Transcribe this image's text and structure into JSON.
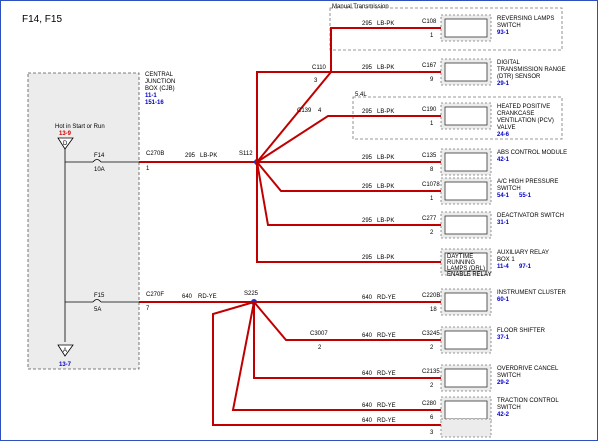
{
  "title": "F14, F15",
  "cjb": {
    "name": "CENTRAL JUNCTION BOX (CJB)",
    "ref": "11-1",
    "ref2": "151-16"
  },
  "hot_label": "Hot in Start or Run",
  "hot_ref": "13-9",
  "ground_ref": "13-7",
  "fuses": [
    {
      "name": "F14",
      "rating": "10A",
      "connector": "C270B",
      "pin": "1",
      "circuit": "295",
      "color": "LB-PK"
    },
    {
      "name": "F15",
      "rating": "5A",
      "connector": "C270F",
      "pin": "7",
      "circuit": "640",
      "color": "RD-YE"
    }
  ],
  "splices": [
    "S112",
    "S225"
  ],
  "manual_transmission": "Manual Transmission",
  "engine_tag": "5.4L",
  "connectors_mid": [
    "C110",
    "3",
    "C139",
    "4",
    "C3007",
    "2"
  ],
  "branches": [
    {
      "circuit": "295",
      "color": "LB-PK",
      "conn": "C108",
      "pin": "1",
      "name": "REVERSING LAMPS SWITCH",
      "ref": "93-1"
    },
    {
      "circuit": "295",
      "color": "LB-PK",
      "conn": "C167",
      "pin": "9",
      "name": "DIGITAL TRANSMISSION RANGE (DTR) SENSOR",
      "ref": "29-1"
    },
    {
      "circuit": "295",
      "color": "LB-PK",
      "conn": "C190",
      "pin": "1",
      "name": "HEATED POSITIVE CRANKCASE VENTILATION (PCV) VALVE",
      "ref": "24-6"
    },
    {
      "circuit": "295",
      "color": "LB-PK",
      "conn": "C135",
      "pin": "8",
      "name": "ABS CONTROL MODULE",
      "ref": "42-1"
    },
    {
      "circuit": "295",
      "color": "LB-PK",
      "conn": "C1078",
      "pin": "1",
      "name": "A/C HIGH PRESSURE SWITCH",
      "ref": "54-1",
      "ref2": "55-1"
    },
    {
      "circuit": "295",
      "color": "LB-PK",
      "conn": "C277",
      "pin": "2",
      "name": "DEACTIVATOR SWITCH",
      "ref": "31-1"
    },
    {
      "circuit": "295",
      "color": "LB-PK",
      "conn": "",
      "pin": "",
      "name": "AUXILIARY RELAY BOX 1",
      "inner": "DAYTIME RUNNING LAMPS (DRL) ENABLE RELAY",
      "ref": "11-4",
      "ref2": "97-1"
    },
    {
      "circuit": "640",
      "color": "RD-YE",
      "conn": "C220B",
      "pin": "18",
      "name": "INSTRUMENT CLUSTER",
      "ref": "60-1"
    },
    {
      "circuit": "640",
      "color": "RD-YE",
      "conn": "C3245",
      "pin": "2",
      "name": "FLOOR SHIFTER",
      "ref": "37-1"
    },
    {
      "circuit": "640",
      "color": "RD-YE",
      "conn": "C2135",
      "pin": "2",
      "name": "OVERDRIVE CANCEL SWITCH",
      "ref": "29-2"
    },
    {
      "circuit": "640",
      "color": "RD-YE",
      "conn": "C280",
      "pin": "6",
      "name": "TRACTION CONTROL SWITCH",
      "ref": "42-2"
    },
    {
      "circuit": "640",
      "color": "RD-YE",
      "conn": "",
      "pin": "3",
      "name": "",
      "ref": ""
    }
  ]
}
